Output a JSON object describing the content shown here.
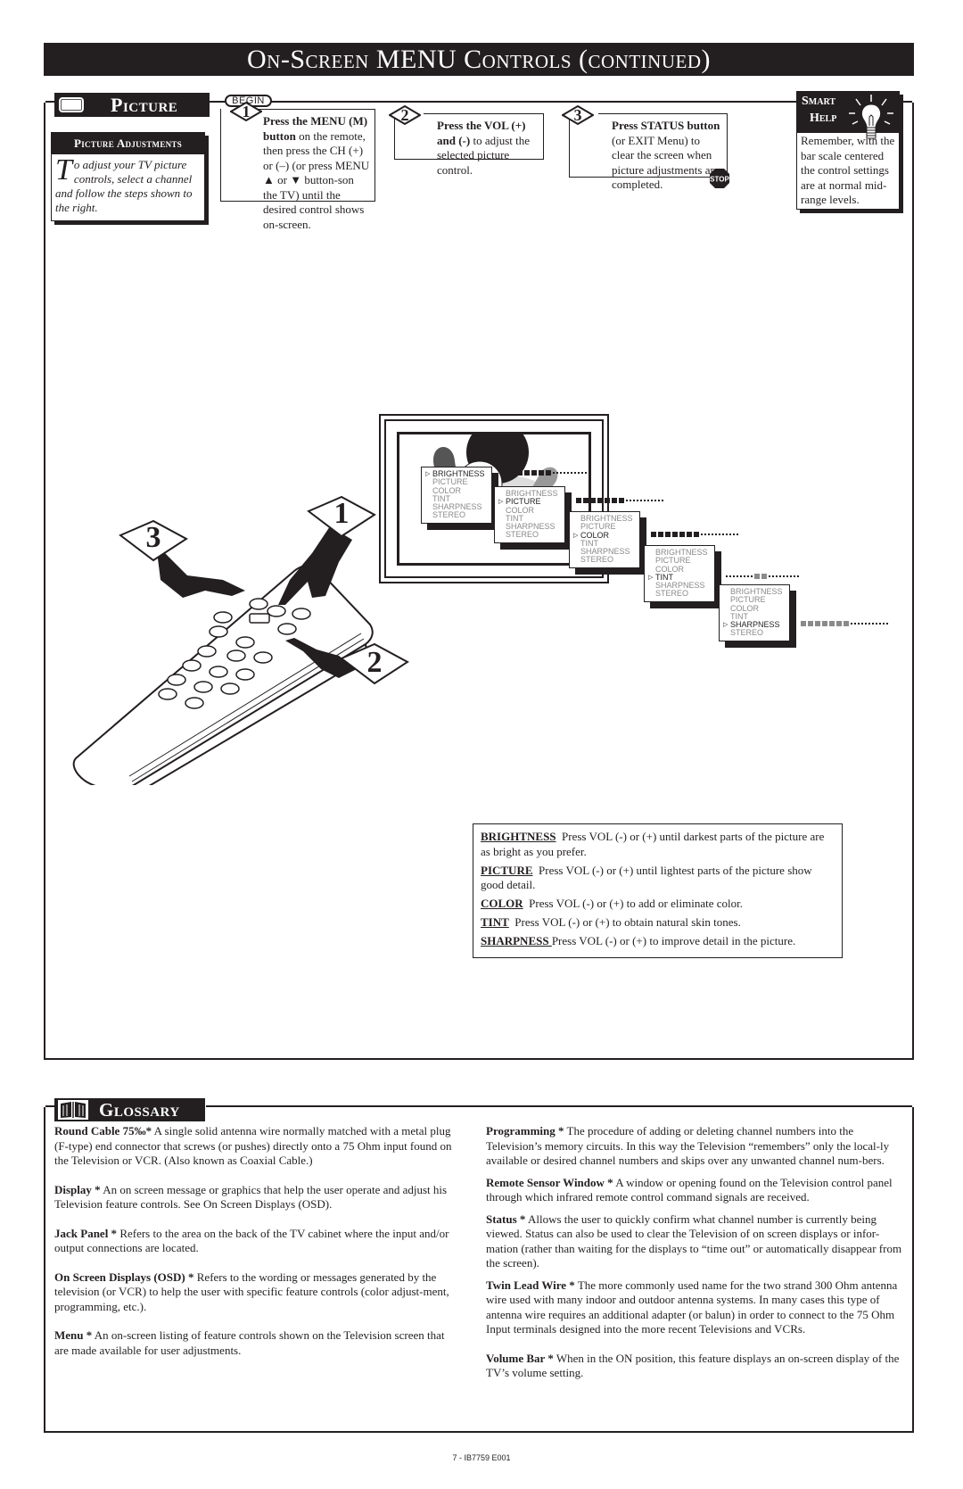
{
  "header": {
    "title": "On-Screen MENU Controls (continued)"
  },
  "picture_section": {
    "tab_label": "Picture",
    "tab_icon": "tv-icon",
    "adjustments": {
      "heading": "Picture Adjustments",
      "drop_cap": "T",
      "text": "o adjust your TV picture controls, select a channel and follow the steps shown to the right."
    },
    "begin_label": "BEGIN",
    "steps": [
      {
        "number": "1",
        "bold_text": "Press the MENU (M) button",
        "text": " on the remote, then press the CH (+) or (–) (or press MENU ▲ or ▼ button-son the TV) until the desired control shows on-screen."
      },
      {
        "number": "2",
        "bold_text": "Press the VOL (+) and (-)",
        "text": " to adjust the selected picture control."
      },
      {
        "number": "3",
        "bold_text": "Press STATUS button",
        "text": " (or EXIT Menu) to clear the screen when picture adjustments are completed."
      }
    ],
    "stop_label": "STOP",
    "smart_help": {
      "title_line1": "Smart",
      "title_line2": "Help",
      "icon": "lightbulb-icon",
      "text": "Remember, with the bar scale centered the control settings are at normal mid-range levels."
    },
    "illustration": {
      "callouts": [
        "1",
        "2",
        "3"
      ],
      "menus": [
        {
          "items": [
            "BRIGHTNESS",
            "PICTURE",
            "COLOR",
            "TINT",
            "SHARPNESS",
            "STEREO"
          ],
          "selected": 0,
          "bar_level": 7,
          "bar_color": "#231f20"
        },
        {
          "items": [
            "BRIGHTNESS",
            "PICTURE",
            "COLOR",
            "TINT",
            "SHARPNESS",
            "STEREO"
          ],
          "selected": 1,
          "bar_level": 7,
          "bar_color": "#231f20"
        },
        {
          "items": [
            "BRIGHTNESS",
            "PICTURE",
            "COLOR",
            "TINT",
            "SHARPNESS",
            "STEREO"
          ],
          "selected": 2,
          "bar_level": 7,
          "bar_color": "#231f20"
        },
        {
          "items": [
            "BRIGHTNESS",
            "PICTURE",
            "COLOR",
            "TINT",
            "SHARPNESS",
            "STEREO"
          ],
          "selected": 3,
          "bar_level": 2,
          "bar_color": "#8a8a8a",
          "centered": true
        },
        {
          "items": [
            "BRIGHTNESS",
            "PICTURE",
            "COLOR",
            "TINT",
            "SHARPNESS",
            "STEREO"
          ],
          "selected": 4,
          "bar_level": 7,
          "bar_color": "#8a8a8a"
        }
      ]
    },
    "descriptions": [
      {
        "term": "BRIGHTNESS",
        "text": "Press VOL (-) or (+) until darkest parts of the picture are as bright as you prefer."
      },
      {
        "term": "PICTURE",
        "text": "Press VOL (-) or (+) until lightest parts of the picture show good detail."
      },
      {
        "term": "COLOR",
        "text": "Press VOL (-) or (+) to add or eliminate color."
      },
      {
        "term": "TINT",
        "text": "Press VOL (-) or (+) to obtain natural skin tones."
      },
      {
        "term": "SHARPNESS ",
        "text": "Press VOL (-) or (+) to improve detail in the picture."
      }
    ]
  },
  "glossary": {
    "tab_label": "Glossary",
    "tab_icon": "book-icon",
    "left": [
      {
        "term": "Round Cable 75‰*",
        "text": " A single solid antenna wire normally matched with a metal plug (F-type) end connector that screws (or pushes) directly onto a 75 Ohm input found on the Television or VCR. (Also known as Coaxial Cable.)"
      },
      {
        "term": "Display *",
        "text": " An on screen message or graphics that help the user operate and adjust his Television feature controls. See On Screen Displays (OSD)."
      },
      {
        "term": "Jack Panel *",
        "text": " Refers to the area on the back of the TV cabinet where the input and/or output connections are located."
      },
      {
        "term": "On Screen Displays (OSD) *",
        "text": " Refers to the wording or messages generated by the television (or VCR) to help the user with specific feature controls (color adjust-ment, programming, etc.)."
      },
      {
        "term": "Menu *",
        "text": " An on-screen listing of feature controls shown on the Television screen that are made available for user adjustments."
      }
    ],
    "right": [
      {
        "term": "Programming *",
        "text": " The procedure of adding or deleting channel numbers into the Television’s memory circuits. In this way the Television “remembers” only the local-ly available or desired channel numbers and skips over any unwanted channel num-bers."
      },
      {
        "term": "Remote Sensor Window *",
        "text": " A window or opening found on the Television control panel through which infrared remote control command signals are received."
      },
      {
        "term": "Status *",
        "text": " Allows the user to quickly confirm what channel number is currently being viewed. Status can also be used to clear the Television of on screen displays or infor-mation (rather than waiting for the displays to “time out” or automatically disappear from the screen)."
      },
      {
        "term": "Twin Lead Wire *",
        "text": " The more commonly used name for the two strand 300 Ohm antenna wire used with many indoor and outdoor antenna systems. In many cases this type of antenna wire requires an additional adapter (or balun) in order to connect to the 75 Ohm Input terminals designed into the more recent Televisions and VCRs."
      },
      {
        "term": "Volume Bar *",
        "text": "  When in the ON position, this feature displays an on-screen display of the TV’s volume setting."
      }
    ]
  },
  "footer": {
    "text": "7 - IB7759 E001"
  }
}
